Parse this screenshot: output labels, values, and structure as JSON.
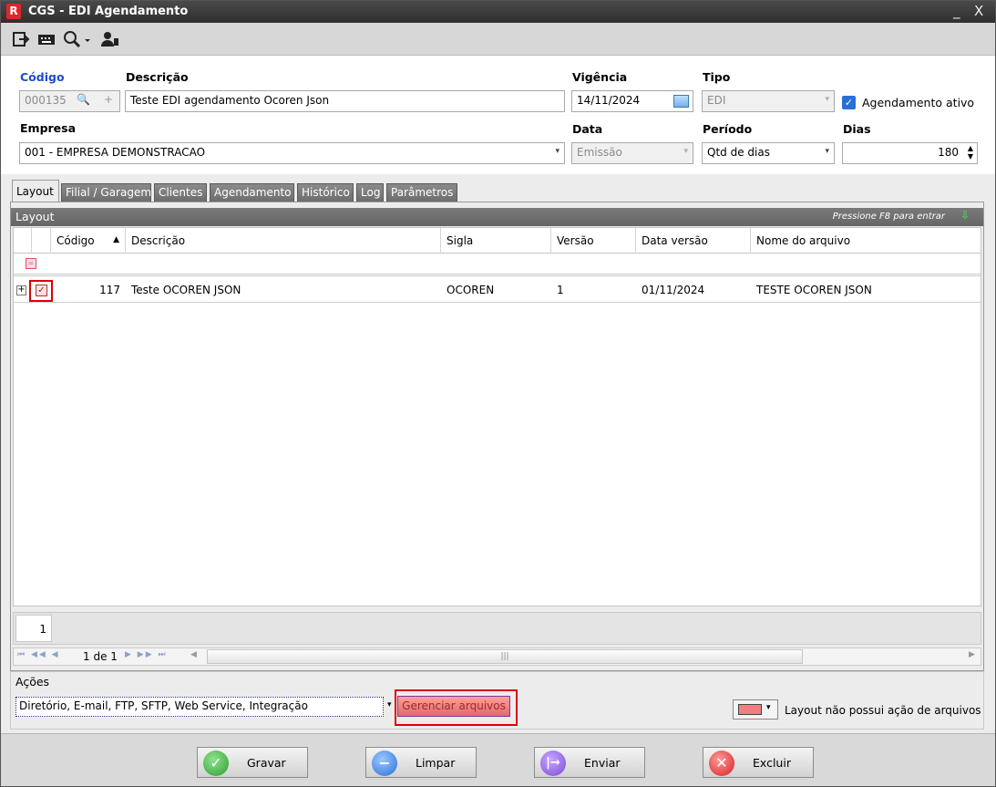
{
  "window": {
    "title": "CGS - EDI Agendamento",
    "logo": "R",
    "minimize": "_",
    "close": "X"
  },
  "form": {
    "codigo": {
      "label": "Código",
      "value": "000135"
    },
    "descricao": {
      "label": "Descrição",
      "value": "Teste EDI agendamento Ocoren Json"
    },
    "vigencia": {
      "label": "Vigência",
      "value": "14/11/2024"
    },
    "tipo": {
      "label": "Tipo",
      "value": "EDI"
    },
    "agendamento_ativo": {
      "label": "Agendamento ativo",
      "checked": true
    },
    "empresa": {
      "label": "Empresa",
      "value": "001 - EMPRESA DEMONSTRACAO"
    },
    "data": {
      "label": "Data",
      "value": "Emissão"
    },
    "periodo": {
      "label": "Período",
      "value": "Qtd de dias"
    },
    "dias": {
      "label": "Dias",
      "value": "180"
    }
  },
  "tabs": [
    "Layout",
    "Filial / Garagem",
    "Clientes",
    "Agendamento",
    "Histórico",
    "Log",
    "Parâmetros"
  ],
  "panel": {
    "title": "Layout",
    "hint": "Pressione F8 para entrar"
  },
  "grid": {
    "columns": [
      "Código",
      "Descrição",
      "Sigla",
      "Versão",
      "Data versão",
      "Nome do arquivo"
    ],
    "rows": [
      {
        "codigo": "117",
        "descricao": "Teste OCOREN JSON",
        "sigla": "OCOREN",
        "versao": "1",
        "data_versao": "01/11/2024",
        "nome_arquivo": "TESTE OCOREN JSON"
      }
    ]
  },
  "pager": {
    "page_number": "1",
    "page_info": "1 de 1"
  },
  "acoes": {
    "label": "Ações",
    "value": "Diretório, E-mail, FTP, SFTP, Web Service, Integração",
    "button": "Gerenciar arquivos",
    "legend": "Layout não possui ação de arquivos",
    "legend_color": "#f08080"
  },
  "footer": {
    "gravar": "Gravar",
    "limpar": "Limpar",
    "enviar": "Enviar",
    "excluir": "Excluir"
  }
}
